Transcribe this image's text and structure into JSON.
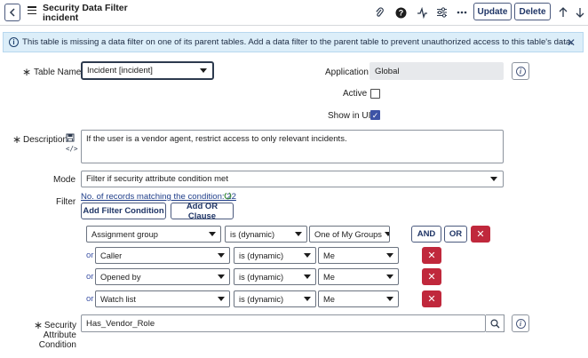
{
  "header": {
    "title_line1": "Security Data Filter",
    "title_line2": "incident",
    "update_label": "Update",
    "delete_label": "Delete"
  },
  "banner": {
    "message": "This table is missing a data filter on one of its parent tables. Add a data filter to the parent table to prevent unauthorized access to this table's data."
  },
  "form": {
    "table_name": {
      "label": "Table Name",
      "value": "Incident [incident]"
    },
    "application": {
      "label": "Application",
      "value": "Global"
    },
    "active": {
      "label": "Active",
      "checked": false
    },
    "show_in_ui": {
      "label": "Show in UI",
      "checked": true
    },
    "description": {
      "label": "Description",
      "value": "If the user is a vendor agent, restrict access to only relevant incidents."
    },
    "mode": {
      "label": "Mode",
      "value": "Filter if security attribute condition met"
    },
    "filter": {
      "label": "Filter",
      "records_link": "No. of records matching the condition: 22",
      "add_filter_label": "Add Filter Condition",
      "add_or_label": "Add OR Clause",
      "and_label": "AND",
      "or_label": "OR",
      "or_prefix": "or",
      "conditions": [
        {
          "field": "Assignment group",
          "operator": "is (dynamic)",
          "value": "One of My Groups"
        },
        {
          "field": "Caller",
          "operator": "is (dynamic)",
          "value": "Me"
        },
        {
          "field": "Opened by",
          "operator": "is (dynamic)",
          "value": "Me"
        },
        {
          "field": "Watch list",
          "operator": "is (dynamic)",
          "value": "Me"
        }
      ]
    },
    "security_attribute": {
      "label_line1": "Security",
      "label_line2": "Attribute",
      "label_line3": "Condition",
      "value": "Has_Vendor_Role"
    }
  },
  "icons": [
    "back-icon",
    "menu-icon",
    "paperclip-icon",
    "help-icon",
    "activity-icon",
    "settings-sliders-icon",
    "more-icon",
    "arrow-up-icon",
    "arrow-down-icon",
    "info-icon",
    "close-icon",
    "search-icon",
    "spell-check-icon",
    "code-icon",
    "refresh-icon"
  ],
  "colors": {
    "accent": "#3d53a6",
    "danger": "#c0283c",
    "banner_bg": "#dceef9"
  }
}
